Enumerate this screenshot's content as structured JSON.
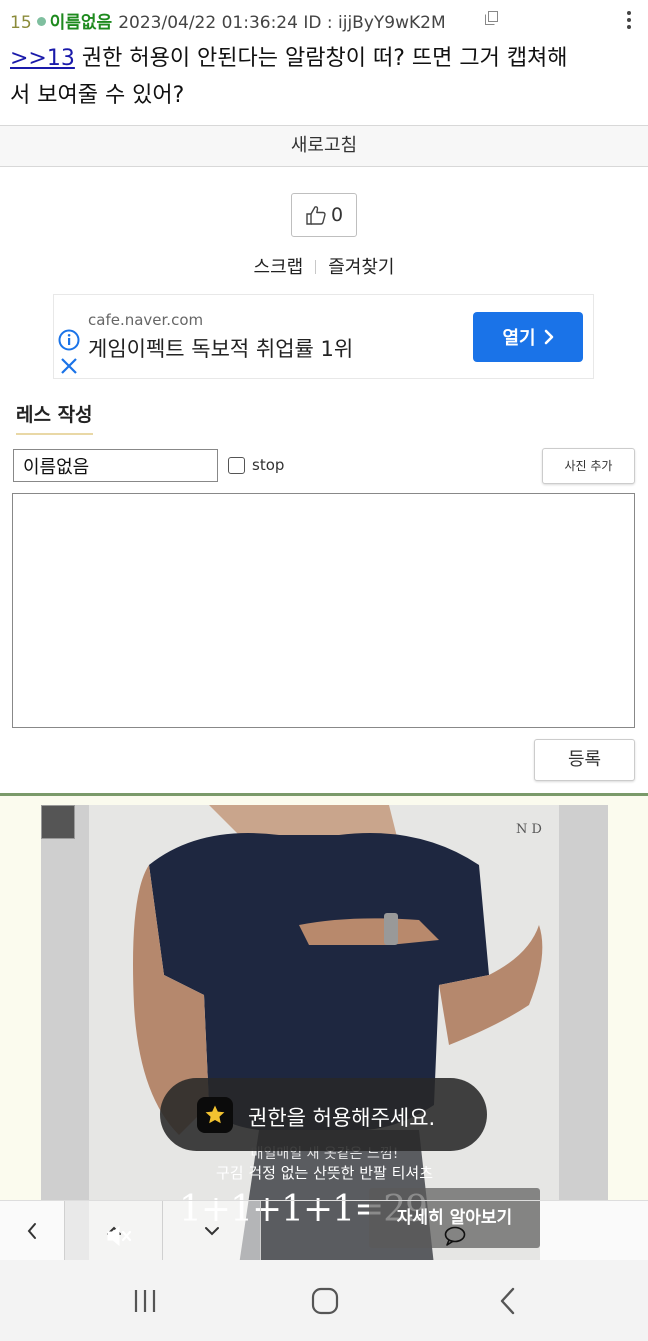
{
  "post": {
    "number": "15",
    "author": "이름없음",
    "datetime": "2023/04/22 01:36:24",
    "id_label": "ID : ijjByY9wK2M",
    "reply_link": ">>13",
    "text_line1": " 권한 허용이 안된다는 알람창이 떠? 뜨면 그거 캡쳐해",
    "text_line2": "서 보여줄 수 있어?"
  },
  "refresh_label": "새로고침",
  "like": {
    "count": "0",
    "icon": "thumbs-up-icon"
  },
  "actions": {
    "scrap": "스크랩",
    "favorite": "즐겨찾기"
  },
  "ad_banner": {
    "domain": "cafe.naver.com",
    "headline": "게임이펙트 독보적 취업률 1위",
    "button": "열기",
    "accent": "#1a73e8"
  },
  "reply_form": {
    "title": "레스 작성",
    "name_value": "이름없음",
    "stop_label": "stop",
    "photo_button": "사진 추가",
    "submit_button": "등록"
  },
  "video_ad": {
    "caption1": "매일매일 새 옷같은 느낌!",
    "caption2": "구김 걱정 없는 산뜻한 반팔 티셔츠",
    "price": "1+1+1+1=29",
    "cta": "자세히 알아보기",
    "brand_mark": "N D"
  },
  "toast": {
    "message": "권한을 허용해주세요.",
    "icon": "star-icon"
  }
}
